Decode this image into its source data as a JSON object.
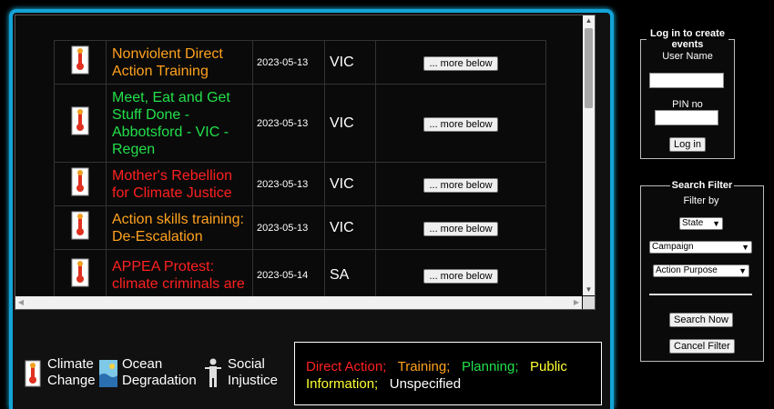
{
  "events": [
    {
      "title": "Nonviolent Direct Action Training",
      "type": "training",
      "date": "2023-05-13",
      "state": "VIC",
      "more": "... more below"
    },
    {
      "title": "Meet, Eat and Get Stuff Done - Abbotsford - VIC - Regen",
      "type": "planning",
      "date": "2023-05-13",
      "state": "VIC",
      "more": "... more below"
    },
    {
      "title": "Mother's Rebellion for Climate Justice",
      "type": "direct",
      "date": "2023-05-13",
      "state": "VIC",
      "more": "... more below"
    },
    {
      "title": "Action skills training: De-Escalation",
      "type": "training",
      "date": "2023-05-13",
      "state": "VIC",
      "more": "... more below"
    },
    {
      "title": "APPEA Protest: climate criminals are",
      "type": "direct",
      "date": "2023-05-14",
      "state": "SA",
      "more": "... more below"
    }
  ],
  "type_colors": {
    "direct": "#ff2020",
    "training": "#ffa21e",
    "planning": "#22e04a",
    "public": "#ffff33",
    "unspecified": "#ffffff"
  },
  "legend": {
    "climate": "Climate Change",
    "ocean": "Ocean Degradation",
    "social": "Social Injustice"
  },
  "key": {
    "direct": "Direct Action;",
    "training": "Training;",
    "planning": "Planning;",
    "public": "Public Information;",
    "unspecified": "Unspecified"
  },
  "login": {
    "title": "Log in to create events",
    "user_label": "User Name",
    "user_value": "",
    "pin_label": "PIN no",
    "pin_value": "",
    "button": "Log in"
  },
  "search": {
    "title": "Search Filter",
    "filter_by": "Filter by",
    "state": "State",
    "campaign": "Campaign",
    "purpose": "Action Purpose",
    "search_button": "Search Now",
    "cancel_button": "Cancel Filter"
  },
  "icons": {
    "event": "climate-change-thermometer-icon",
    "ocean": "ocean-degradation-icon",
    "social": "social-injustice-icon"
  }
}
